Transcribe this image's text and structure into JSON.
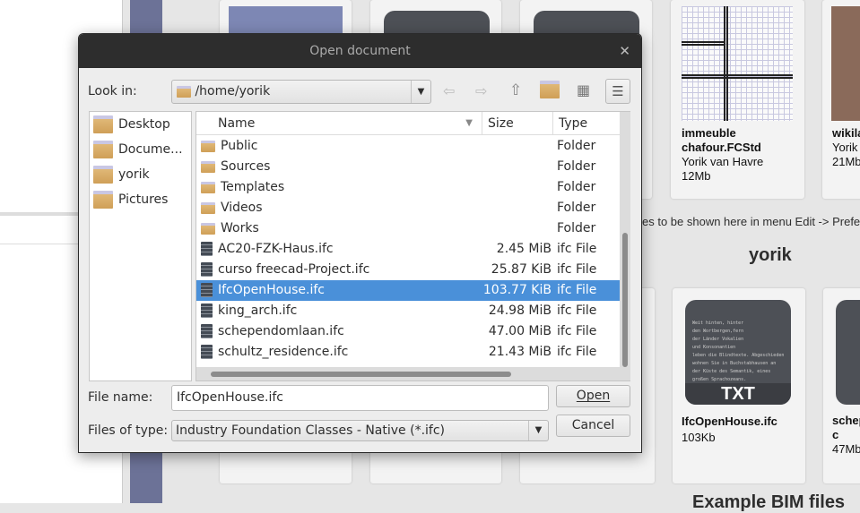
{
  "background": {
    "hint_text": "es to be shown here in menu Edit -> Prefe",
    "section_title": "yorik",
    "section2_title": "Example BIM files",
    "cards_top": [
      {
        "title": "immeuble chafour.FCStd",
        "author": "Yorik van Havre",
        "size": "12Mb"
      },
      {
        "title": "wikila",
        "author": "Yorik",
        "size": "21Mb"
      }
    ],
    "cards_bottom": [
      {
        "title": "IfcOpenHouse.ifc",
        "size": "103Kb",
        "thumb_label": "TXT"
      },
      {
        "title": "schep c",
        "size": "47Mb"
      }
    ],
    "thumb_text": "Weit hinten, hinter\nden Wortbergen,fern\nder Länder Vokalien\nund Konsonantien\nleben die Blindtexte. Abgeschieden\nwohnen Sie in Buchstabhausen an\nder Küste des Semantik, eines\ngroßen Sprachozeans."
  },
  "dialog": {
    "title": "Open document",
    "look_in_label": "Look in:",
    "look_in_value": "/home/yorik",
    "places": [
      "Desktop",
      "Docume...",
      "yorik",
      "Pictures"
    ],
    "columns": [
      "Name",
      "Size",
      "Type"
    ],
    "files": [
      {
        "name": "Public",
        "size": "",
        "type": "Folder",
        "kind": "folder"
      },
      {
        "name": "Sources",
        "size": "",
        "type": "Folder",
        "kind": "folder"
      },
      {
        "name": "Templates",
        "size": "",
        "type": "Folder",
        "kind": "folder"
      },
      {
        "name": "Videos",
        "size": "",
        "type": "Folder",
        "kind": "folder"
      },
      {
        "name": "Works",
        "size": "",
        "type": "Folder",
        "kind": "folder"
      },
      {
        "name": "AC20-FZK-Haus.ifc",
        "size": "2.45 MiB",
        "type": "ifc File",
        "kind": "file"
      },
      {
        "name": "curso freecad-Project.ifc",
        "size": "25.87 KiB",
        "type": "ifc File",
        "kind": "file"
      },
      {
        "name": "IfcOpenHouse.ifc",
        "size": "103.77 KiB",
        "type": "ifc File",
        "kind": "file",
        "selected": true
      },
      {
        "name": "king_arch.ifc",
        "size": "24.98 MiB",
        "type": "ifc File",
        "kind": "file"
      },
      {
        "name": "schependomlaan.ifc",
        "size": "47.00 MiB",
        "type": "ifc File",
        "kind": "file"
      },
      {
        "name": "schultz_residence.ifc",
        "size": "21.43 MiB",
        "type": "ifc File",
        "kind": "file"
      }
    ],
    "file_name_label": "File name:",
    "file_name_value": "IfcOpenHouse.ifc",
    "files_of_type_label": "Files of type:",
    "files_of_type_value": "Industry Foundation Classes - Native (*.ifc)",
    "open_label": "Open",
    "cancel_label": "Cancel",
    "accent": "#4a90d9"
  }
}
